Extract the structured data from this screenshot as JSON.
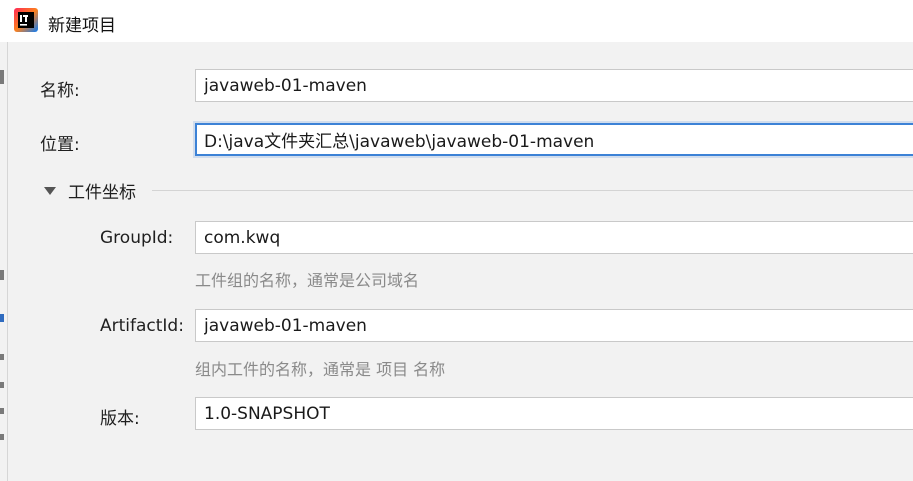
{
  "window": {
    "title": "新建项目",
    "icon": "intellij-idea-icon"
  },
  "form": {
    "name": {
      "label": "名称:",
      "value": "javaweb-01-maven"
    },
    "location": {
      "label": "位置:",
      "value": "D:\\java文件夹汇总\\javaweb\\javaweb-01-maven"
    },
    "coordinates": {
      "section_label": "工件坐标",
      "section_icon": "triangle-expanded-icon",
      "group_id": {
        "label": "GroupId:",
        "value": "com.kwq",
        "hint": "工件组的名称，通常是公司域名"
      },
      "artifact_id": {
        "label": "ArtifactId:",
        "value": "javaweb-01-maven",
        "hint": "组内工件的名称，通常是 项目 名称"
      },
      "version": {
        "label": "版本:",
        "value": "1.0-SNAPSHOT"
      }
    }
  },
  "colors": {
    "focus_border": "#3c82d6",
    "hint_text": "#8a8a8a",
    "background": "#f2f2f2"
  }
}
